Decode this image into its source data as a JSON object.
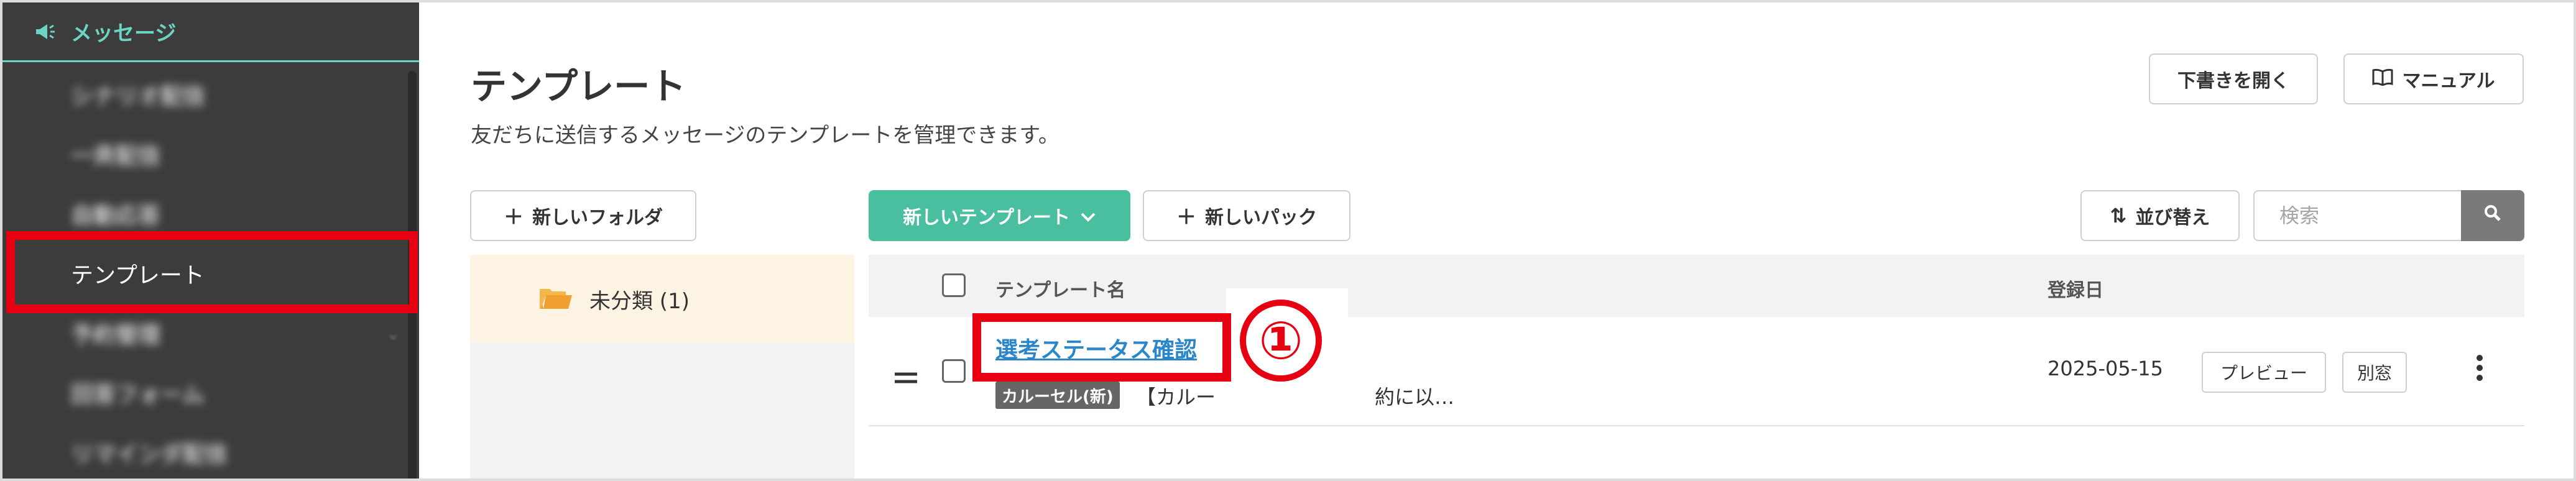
{
  "sidebar": {
    "header": {
      "label": "メッセージ",
      "icon": "megaphone-icon"
    },
    "items": [
      {
        "label": "シナリオ配信",
        "blurred": true
      },
      {
        "label": "一斉配信",
        "blurred": true
      },
      {
        "label": "自動応答",
        "blurred": true
      },
      {
        "label": "テンプレート",
        "active": true
      },
      {
        "label": "予約管理",
        "blurred": true,
        "expandable": true
      },
      {
        "label": "回答フォーム",
        "blurred": true
      },
      {
        "label": "リマインダ配信",
        "blurred": true
      }
    ]
  },
  "header": {
    "title": "テンプレート",
    "subtitle": "友だちに送信するメッセージのテンプレートを管理できます。",
    "draft_button": "下書きを開く",
    "manual_button": "マニュアル"
  },
  "toolbar": {
    "new_folder": "新しいフォルダ",
    "new_template": "新しいテンプレート",
    "new_pack": "新しいパック",
    "sort": "並び替え",
    "search_placeholder": "検索"
  },
  "folders": [
    {
      "name": "未分類 (1)"
    }
  ],
  "table": {
    "columns": {
      "name": "テンプレート名",
      "date": "登録日"
    },
    "rows": [
      {
        "name": "選考ステータス確認",
        "badge": "カルーセル(新)",
        "preview": "【カルー　　　　　　　　約に以…",
        "date": "2025-05-15",
        "preview_button": "プレビュー",
        "new_window_button": "別窓"
      }
    ]
  },
  "annotation": {
    "step_number": "①"
  },
  "colors": {
    "accent": "#49bfa0",
    "sidebar_bg": "#3c3c3c",
    "sidebar_accent": "#6dd3c3",
    "highlight_red": "#e60012",
    "link_blue": "#2a86c8"
  }
}
